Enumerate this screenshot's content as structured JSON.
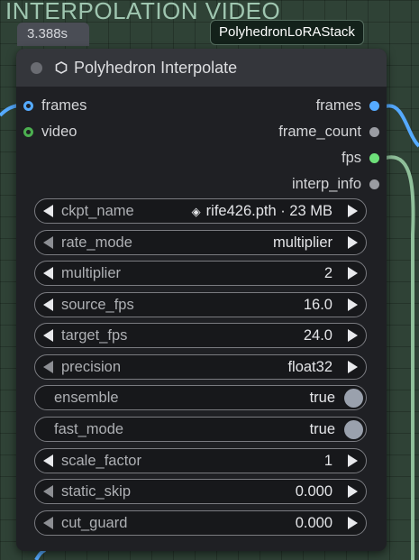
{
  "canvas": {
    "group_title": "INTERPOLATION VIDEO",
    "timing_badge": "3.388s",
    "adjacent_node_tag": "PolyhedronLoRAStack"
  },
  "node": {
    "title": "Polyhedron Interpolate",
    "title_icon": "hexagon-icon",
    "inputs": [
      {
        "label": "frames",
        "connected": true,
        "color": "#55aaff"
      },
      {
        "label": "video",
        "connected": false,
        "color": "#4caf50"
      }
    ],
    "outputs": [
      {
        "label": "frames",
        "connected": true,
        "color": "#55aaff"
      },
      {
        "label": "frame_count",
        "connected": false,
        "color": "#9a9ca2"
      },
      {
        "label": "fps",
        "connected": true,
        "color": "#6ee07a"
      },
      {
        "label": "interp_info",
        "connected": false,
        "color": "#9a9ca2"
      }
    ],
    "widgets": [
      {
        "name": "ckpt_name",
        "value": "rife426.pth · 23 MB",
        "kind": "combo",
        "value_icon": "diamond-icon"
      },
      {
        "name": "rate_mode",
        "value": "multiplier",
        "kind": "combo"
      },
      {
        "name": "multiplier",
        "value": "2",
        "kind": "number"
      },
      {
        "name": "source_fps",
        "value": "16.0",
        "kind": "number"
      },
      {
        "name": "target_fps",
        "value": "24.0",
        "kind": "number"
      },
      {
        "name": "precision",
        "value": "float32",
        "kind": "combo"
      },
      {
        "name": "ensemble",
        "value": "true",
        "kind": "toggle"
      },
      {
        "name": "fast_mode",
        "value": "true",
        "kind": "toggle"
      },
      {
        "name": "scale_factor",
        "value": "1",
        "kind": "number"
      },
      {
        "name": "static_skip",
        "value": "0.000",
        "kind": "number"
      },
      {
        "name": "cut_guard",
        "value": "0.000",
        "kind": "number"
      }
    ]
  },
  "colors": {
    "canvas_bg": "#2f4236",
    "node_bg": "#1f2024",
    "node_header": "#34363b",
    "wire_blue": "#55aaff",
    "wire_green": "#8fbf9a"
  }
}
